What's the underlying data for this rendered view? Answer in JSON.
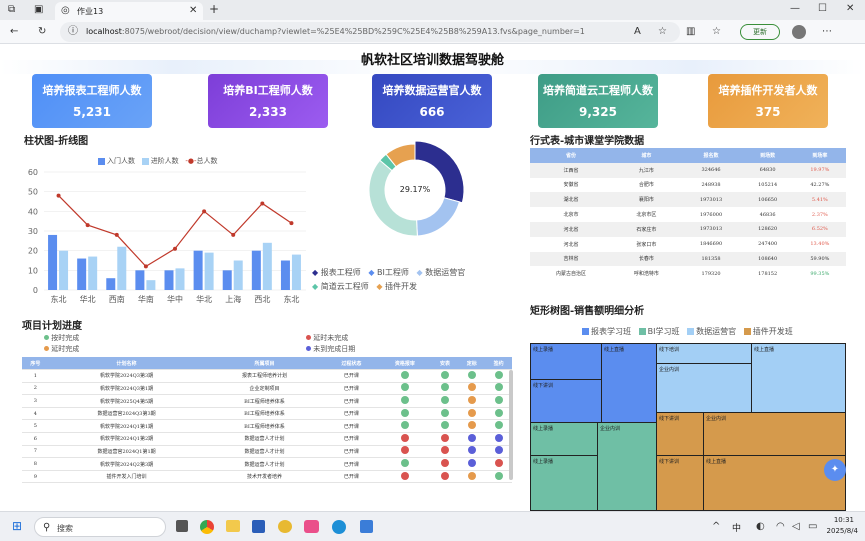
{
  "browser": {
    "tab_title": "作业13",
    "url_host": "localhost",
    "url_rest": ":8075/webroot/decision/view/duchamp?viewlet=%25E4%25BD%259C%25E4%25B8%259A13.fvs&page_number=1",
    "update_label": "更新"
  },
  "dashboard": {
    "title": "帆软社区培训数据驾驶舱",
    "cards": [
      {
        "label": "培养报表工程师人数",
        "value": "5,231"
      },
      {
        "label": "培养BI工程师人数",
        "value": "2,333"
      },
      {
        "label": "培养数据运营官人数",
        "value": "666"
      },
      {
        "label": "培养简道云工程师人数",
        "value": "9,325"
      },
      {
        "label": "培养插件开发者人数",
        "value": "375"
      }
    ],
    "bar_section_title": "柱状图-折线图",
    "donut_center": "29.17%",
    "donut_legend": [
      "报表工程师",
      "BI工程师",
      "数据运营官",
      "简道云工程师",
      "插件开发"
    ],
    "city_section_title": "行式表-城市课堂学院数据",
    "city_table": {
      "headers": [
        "省份",
        "城市",
        "报名数",
        "到场数",
        "到场率"
      ],
      "rows": [
        [
          "江西省",
          "九江市",
          "324646",
          "64830",
          "19.97%"
        ],
        [
          "安徽省",
          "合肥市",
          "248938",
          "105214",
          "42.27%"
        ],
        [
          "湖北省",
          "襄阳市",
          "1973013",
          "106650",
          "5.41%"
        ],
        [
          "北京市",
          "北京市区",
          "1976000",
          "46836",
          "2.37%"
        ],
        [
          "河北省",
          "石家庄市",
          "1973013",
          "128620",
          "6.52%"
        ],
        [
          "河北省",
          "张家口市",
          "1846690",
          "247400",
          "13.40%"
        ],
        [
          "吉林省",
          "长春市",
          "181358",
          "108640",
          "59.90%"
        ],
        [
          "内蒙古自治区",
          "呼和浩特市",
          "179320",
          "178152",
          "99.35%"
        ]
      ],
      "rate_colors": [
        "#e0584a",
        "#333333",
        "#e0584a",
        "#e0584a",
        "#e0584a",
        "#e0584a",
        "#333333",
        "#3aa86a"
      ]
    },
    "project_section_title": "项目计划进度",
    "project_legend": [
      "按时完成",
      "延时完成",
      "延时未完成",
      "未到完成日期"
    ],
    "project_table": {
      "headers": [
        "序号",
        "计划名称",
        "所属项目",
        "过程状态",
        "资格报审",
        "安表",
        "定标",
        "签约"
      ],
      "rows": [
        [
          "1",
          "帆软学院2024Q3第3期",
          "报表工程师培养计划",
          "已开课",
          "g",
          "g",
          "g",
          "g"
        ],
        [
          "2",
          "帆软学院2024Q3第1期",
          "企业定制项目",
          "已开课",
          "g",
          "g",
          "o",
          "g"
        ],
        [
          "3",
          "帆软学院2025Q4第5期",
          "BI工程师培养体系",
          "已开课",
          "g",
          "g",
          "o",
          "g"
        ],
        [
          "4",
          "数据运营官2024Q3第3期",
          "BI工程师培养体系",
          "已开课",
          "g",
          "g",
          "o",
          "g"
        ],
        [
          "5",
          "帆软学院2024Q1第1期",
          "BI工程师培养体系",
          "已开课",
          "g",
          "g",
          "o",
          "g"
        ],
        [
          "6",
          "帆软学院2024Q1第2期",
          "数据运营人才计划",
          "已开课",
          "r",
          "r",
          "b",
          "b"
        ],
        [
          "7",
          "数据运营官2024Q1第1期",
          "数据运营人才计划",
          "已开课",
          "r",
          "r",
          "b",
          "b"
        ],
        [
          "8",
          "帆软学院2024Q2第3期",
          "数据运营人才计划",
          "已开课",
          "g",
          "r",
          "b",
          "r"
        ],
        [
          "9",
          "插件开发入门培训",
          "技术开发者培养",
          "已开课",
          "r",
          "r",
          "o",
          "g"
        ]
      ]
    },
    "treemap_section_title": "矩形树图-销售额明细分析",
    "treemap_legend": [
      "报表学习班",
      "BI学习班",
      "数据运营官",
      "插件开发班"
    ],
    "treemap_labels": [
      "线上录播",
      "线上直播",
      "线下培训",
      "线上直播",
      "线下讲训",
      "企业内训",
      "线上录播",
      "企业内训",
      "线下讲训",
      "企业内训",
      "线上录播",
      "线下讲训",
      "线上直播"
    ]
  },
  "chart_data": {
    "type": "bar",
    "categories": [
      "东北",
      "华北",
      "西南",
      "华南",
      "华中",
      "华北",
      "上海",
      "西北",
      "东北"
    ],
    "series": [
      {
        "name": "入门人数",
        "values": [
          28,
          16,
          6,
          10,
          10,
          20,
          10,
          20,
          15
        ]
      },
      {
        "name": "进阶人数",
        "values": [
          20,
          17,
          22,
          5,
          11,
          19,
          15,
          24,
          18
        ]
      },
      {
        "name": "总人数",
        "values": [
          48,
          33,
          28,
          12,
          21,
          40,
          28,
          44,
          34
        ]
      }
    ],
    "ylim": [
      0,
      60
    ],
    "yticks": [
      "60",
      "50",
      "40",
      "30",
      "20",
      "10",
      "0"
    ],
    "colors": [
      "#5b8def",
      "#a8d2f5",
      "#c0392b"
    ]
  },
  "donut": {
    "values": [
      29.17,
      20,
      37,
      3,
      10.83
    ],
    "colors": [
      "#2c2e8f",
      "#a3c3f0",
      "#b7e1d7",
      "#5cc5a8",
      "#e6a150"
    ]
  },
  "taskbar": {
    "search": "搜索",
    "time": "10:31",
    "date": "2025/8/4",
    "ime": "中"
  }
}
